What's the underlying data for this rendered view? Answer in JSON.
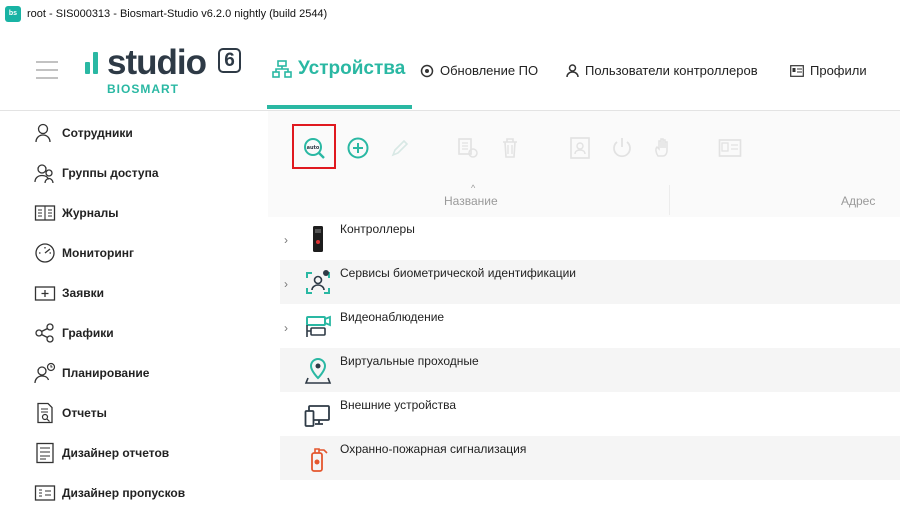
{
  "window": {
    "title": "root - SIS000313 - Biosmart-Studio v6.2.0 nightly (build 2544)"
  },
  "logo": {
    "word": "studio",
    "version": "6",
    "sub": "BIOSMART"
  },
  "nav": {
    "devices": "Устройства",
    "update": "Обновление ПО",
    "users": "Пользователи контроллеров",
    "profiles": "Профили"
  },
  "sidebar": {
    "items": [
      {
        "label": "Сотрудники",
        "icon": "person-icon"
      },
      {
        "label": "Группы доступа",
        "icon": "group-icon"
      },
      {
        "label": "Журналы",
        "icon": "journal-icon"
      },
      {
        "label": "Мониторинг",
        "icon": "gauge-icon"
      },
      {
        "label": "Заявки",
        "icon": "request-icon"
      },
      {
        "label": "Графики",
        "icon": "share-graph-icon"
      },
      {
        "label": "Планирование",
        "icon": "planning-icon"
      },
      {
        "label": "Отчеты",
        "icon": "report-icon"
      },
      {
        "label": "Дизайнер отчетов",
        "icon": "report-designer-icon"
      },
      {
        "label": "Дизайнер пропусков",
        "icon": "pass-designer-icon"
      }
    ]
  },
  "toolbar": {
    "auto_search_label": "auto",
    "buttons": [
      "auto-search",
      "add",
      "edit",
      "fingerprint",
      "delete",
      "user-card",
      "power",
      "hand",
      "id-card"
    ]
  },
  "table": {
    "columns": [
      "Название",
      "Адрес"
    ],
    "rows": [
      {
        "label": "Контроллеры",
        "expandable": true
      },
      {
        "label": "Сервисы биометрической идентификации",
        "expandable": true
      },
      {
        "label": "Видеонаблюдение",
        "expandable": true
      },
      {
        "label": "Виртуальные проходные",
        "expandable": false
      },
      {
        "label": "Внешние устройства",
        "expandable": false
      },
      {
        "label": "Охранно-пожарная сигнализация",
        "expandable": false
      }
    ]
  },
  "colors": {
    "accent": "#2ab8a3",
    "highlight": "#e0191f",
    "text": "#222222"
  }
}
